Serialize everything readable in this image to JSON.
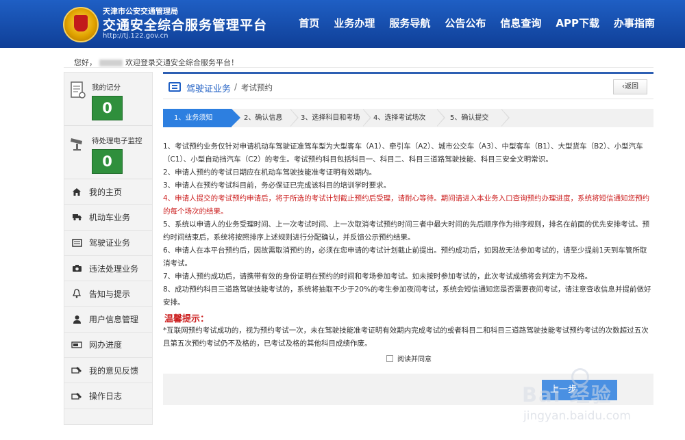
{
  "header": {
    "subtitle": "天津市公安交通管理局",
    "title": "交通安全综合服务管理平台",
    "url": "http://tj.122.gov.cn",
    "nav": [
      "首页",
      "业务办理",
      "服务导航",
      "公告公布",
      "信息查询",
      "APP下载",
      "办事指南"
    ]
  },
  "welcome": {
    "prefix": "您好，",
    "suffix": "欢迎登录交通安全综合服务平台！"
  },
  "sidebar": {
    "stats": [
      {
        "label": "我的记分",
        "value": "0",
        "icon": "document-score-icon"
      },
      {
        "label": "待处理电子监控",
        "value": "0",
        "icon": "camera-monitor-icon"
      }
    ],
    "items": [
      {
        "label": "我的主页",
        "icon": "home-icon"
      },
      {
        "label": "机动车业务",
        "icon": "truck-icon"
      },
      {
        "label": "驾驶证业务",
        "icon": "card-icon"
      },
      {
        "label": "违法处理业务",
        "icon": "camera-icon"
      },
      {
        "label": "告知与提示",
        "icon": "bell-icon"
      },
      {
        "label": "用户信息管理",
        "icon": "user-icon"
      },
      {
        "label": "网办进度",
        "icon": "progress-icon"
      },
      {
        "label": "我的意见反馈",
        "icon": "feedback-icon"
      },
      {
        "label": "操作日志",
        "icon": "log-icon"
      }
    ]
  },
  "breadcrumb": {
    "main": "驾驶证业务",
    "separator": "/",
    "sub": "考试预约",
    "back_label": "返回"
  },
  "steps": [
    {
      "label": "1、业务须知",
      "state": "active"
    },
    {
      "label": "2、确认信息",
      "state": "pending"
    },
    {
      "label": "3、选择科目和考场",
      "state": "pending"
    },
    {
      "label": "4、选择考试场次",
      "state": "pending"
    },
    {
      "label": "5、确认提交",
      "state": "pending"
    }
  ],
  "rules": [
    {
      "text": "1、考试预约业务仅针对申请机动车驾驶证准驾车型为大型客车（A1）、牵引车（A2）、城市公交车（A3）、中型客车（B1）、大型货车（B2）、小型汽车（C1）、小型自动挡汽车（C2）的考生。考试预约科目包括科目一、科目二、科目三道路驾驶技能、科目三安全文明常识。",
      "red": false
    },
    {
      "text": "2、申请人预约的考试日期应在机动车驾驶技能准考证明有效期内。",
      "red": false
    },
    {
      "text": "3、申请人在预约考试科目前，务必保证已完成该科目的培训学时要求。",
      "red": false
    },
    {
      "text": "4、申请人提交的考试预约申请后，将于所选的考试计划截止预约后受理，请耐心等待。期间请进入本业务入口查询预约办理进度，系统将短信通知您预约的每个场次的结果。",
      "red": true
    },
    {
      "text": "5、系统以申请人的业务受理时间、上一次考试时间、上一次取消考试预约时间三者中最大时间的先后顺序作为排序规则，排名在前面的优先安排考试。预约时间结束后，系统将按照排序上述规则进行分配确认，并反馈公示预约结果。",
      "red": false
    },
    {
      "text": "6、申请人在本平台预约后，因故需取消预约的，必须在您申请的考试计划截止前提出。预约成功后，如因故无法参加考试的，请至少提前1天到车管所取消考试。",
      "red": false
    },
    {
      "text": "7、申请人预约成功后，请携带有效的身份证明在预约的时间和考场参加考试。如未按时参加考试的，此次考试成绩将会判定为不及格。",
      "red": false
    },
    {
      "text": "8、成功预约科目三道路驾驶技能考试的，系统将抽取不少于20%的考生参加夜间考试，系统会短信通知您是否需要夜间考试，请注意查收信息并提前做好安排。",
      "red": false
    }
  ],
  "tips": {
    "title": "温馨提示：",
    "body": "*互联网预约考试成功的，视为预约考试一次，未在驾驶技能准考证明有效期内完成考试的或者科目二和科目三道路驾驶技能考试预约考试的次数超过五次且第五次预约考试仍不及格的，已考试及格的其他科目成绩作废。"
  },
  "agree_label": "阅读并同意",
  "next_label": "上一步",
  "watermark": {
    "text": "Bai 经验",
    "url": "jingyan.baidu.com"
  }
}
